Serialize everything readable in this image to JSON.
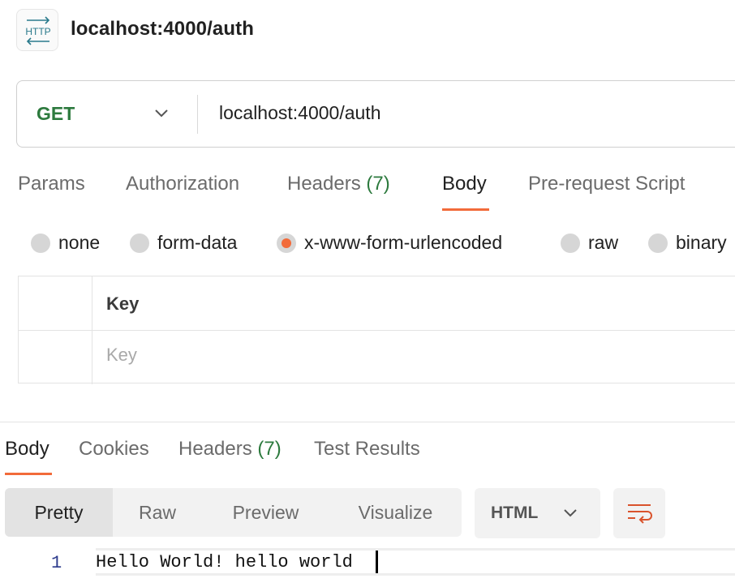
{
  "header": {
    "icon": "http-icon",
    "title": "localhost:4000/auth"
  },
  "url_bar": {
    "method": "GET",
    "url": "localhost:4000/auth"
  },
  "request_tabs": [
    {
      "label": "Params",
      "count": ""
    },
    {
      "label": "Authorization",
      "count": ""
    },
    {
      "label": "Headers",
      "count": "(7)"
    },
    {
      "label": "Body",
      "count": "",
      "active": true
    },
    {
      "label": "Pre-request Script",
      "count": ""
    }
  ],
  "body_types": [
    {
      "label": "none",
      "selected": false
    },
    {
      "label": "form-data",
      "selected": false
    },
    {
      "label": "x-www-form-urlencoded",
      "selected": true
    },
    {
      "label": "raw",
      "selected": false
    },
    {
      "label": "binary",
      "selected": false
    }
  ],
  "kv_table": {
    "header_key": "Key",
    "placeholder_key": "Key"
  },
  "response_tabs": [
    {
      "label": "Body",
      "count": "",
      "active": true
    },
    {
      "label": "Cookies",
      "count": ""
    },
    {
      "label": "Headers",
      "count": "(7)"
    },
    {
      "label": "Test Results",
      "count": ""
    }
  ],
  "view_modes": [
    {
      "label": "Pretty",
      "active": true
    },
    {
      "label": "Raw"
    },
    {
      "label": "Preview"
    },
    {
      "label": "Visualize"
    }
  ],
  "format": "HTML",
  "response_body": {
    "line_number": "1",
    "line_text": "Hello World! hello world"
  },
  "colors": {
    "accent": "#f26b3a",
    "method_green": "#2d7a3e",
    "count_green": "#2d7a3e"
  }
}
